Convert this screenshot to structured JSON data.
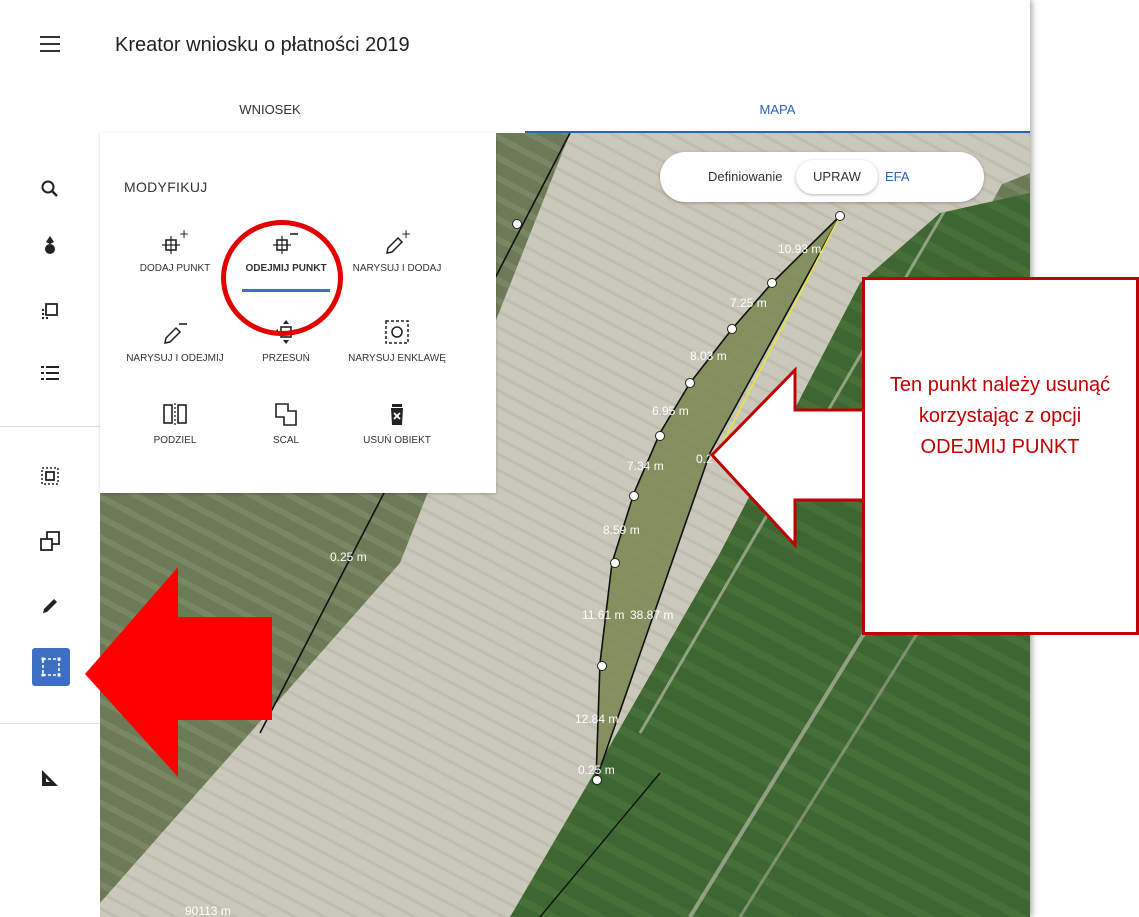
{
  "header": {
    "title": "Kreator wniosku o płatności 2019"
  },
  "tabs": [
    {
      "label": "WNIOSEK"
    },
    {
      "label": "MAPA"
    }
  ],
  "panel": {
    "title": "MODYFIKUJ",
    "tools": [
      {
        "label": "DODAJ PUNKT",
        "icon": "add-point-icon"
      },
      {
        "label": "ODEJMIJ PUNKT",
        "icon": "remove-point-icon"
      },
      {
        "label": "NARYSUJ I DODAJ",
        "icon": "draw-add-icon"
      },
      {
        "label": "NARYSUJ I ODEJMIJ",
        "icon": "draw-subtract-icon"
      },
      {
        "label": "PRZESUŃ",
        "icon": "move-icon"
      },
      {
        "label": "NARYSUJ ENKLAWĘ",
        "icon": "enclave-icon"
      },
      {
        "label": "PODZIEL",
        "icon": "split-icon"
      },
      {
        "label": "SCAL",
        "icon": "merge-icon"
      },
      {
        "label": "USUŃ OBIEKT",
        "icon": "delete-object-icon"
      }
    ]
  },
  "toggle": {
    "label": "Definiowanie",
    "option_active": "UPRAW",
    "option_other": "EFA"
  },
  "callout": {
    "text": "Ten punkt należy usunąć korzystając z opcji ODEJMIJ PUNKT"
  },
  "map_labels": [
    "10.93 m",
    "7.25 m",
    "8.03 m",
    "6.95 m",
    "7.34 m",
    "0.2",
    "8.59 m",
    "11.61 m",
    "38.87 m",
    "12.84 m",
    "0.25 m",
    "0.25 m"
  ],
  "scale": {
    "text": "90113 m"
  },
  "colors": {
    "accent": "#3e6fc3",
    "callout": "#c00000",
    "highlight": "#e30000"
  }
}
